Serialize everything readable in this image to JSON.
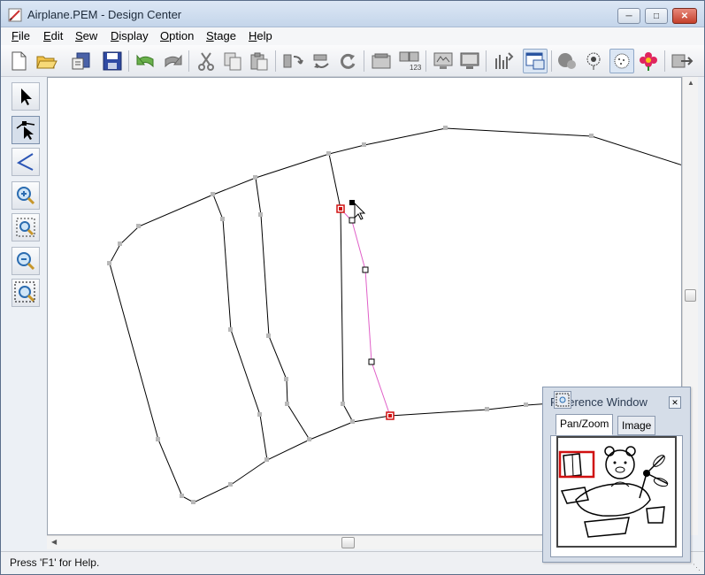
{
  "window": {
    "title": "Airplane.PEM - Design Center",
    "minimize_icon": "minimize-icon",
    "maximize_icon": "maximize-icon",
    "close_icon": "close-icon"
  },
  "menu": [
    {
      "label": "File",
      "mnemonic": "F"
    },
    {
      "label": "Edit",
      "mnemonic": "E"
    },
    {
      "label": "Sew",
      "mnemonic": "S"
    },
    {
      "label": "Display",
      "mnemonic": "D"
    },
    {
      "label": "Option",
      "mnemonic": "O"
    },
    {
      "label": "Stage",
      "mnemonic": "S"
    },
    {
      "label": "Help",
      "mnemonic": "H"
    }
  ],
  "toolbar": {
    "buttons": [
      "new-file-icon",
      "open-folder-icon",
      "import-icon",
      "save-icon",
      "undo-icon",
      "redo-icon",
      "cut-icon",
      "copy-icon",
      "paste-icon",
      "rotate-left-icon",
      "rotate-right-icon",
      "refresh-icon",
      "frame-icon",
      "sequence-icon",
      "monitor-icon",
      "display-icon",
      "stitch-icon",
      "reference-window-icon",
      "color-icon",
      "flower-icon",
      "fill-icon",
      "flower-color-icon",
      "export-icon"
    ]
  },
  "left_tools": [
    "select-arrow-icon",
    "point-edit-icon",
    "line-tool-icon",
    "zoom-in-icon",
    "fit-to-window-icon",
    "zoom-out-icon",
    "zoom-select-icon"
  ],
  "status": {
    "text": "Press 'F1' for Help."
  },
  "reference_window": {
    "title": "Reference Window",
    "tabs": [
      "Pan/Zoom",
      "Image"
    ],
    "active_tab": "Pan/Zoom"
  },
  "colors": {
    "outline": "#000000",
    "selected_segment": "#e060c8",
    "selected_node": "#d01010",
    "node_gray": "#b0b0b0",
    "zoom_rect": "#d01010"
  }
}
